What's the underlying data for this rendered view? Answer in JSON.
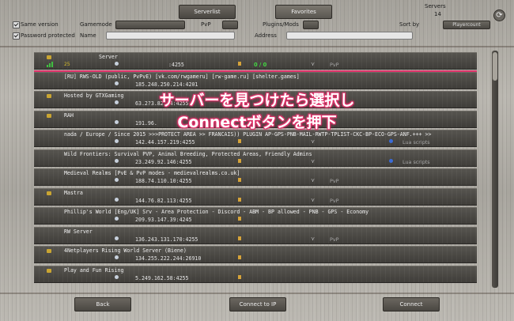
{
  "tabs": [
    {
      "label": "Serverlist",
      "active": true
    },
    {
      "label": "Favorites",
      "active": false
    }
  ],
  "servers_count": {
    "label": "Servers",
    "value": "14"
  },
  "filters": {
    "same_version": "Same version",
    "password_protected": "Password protected",
    "gamemode": "Gamemode",
    "pvp": "PvP",
    "plugins_mods": "Plugins/Mods",
    "name": "Name",
    "address": "Address",
    "sort_by": "Sort by",
    "sort_value": "Playercount"
  },
  "overlay": {
    "line1": "サーバーを見つけたら選択し",
    "line2": "Connectボタンを押下",
    "color": "#e0336b"
  },
  "servers": [
    {
      "name": "Server",
      "address": ":4255",
      "ping": "25",
      "players": "0 / 0",
      "pvp": "PvP",
      "mods": ""
    },
    {
      "name": "[RU] RWS-OLD (public, PvPvE) [vk.com/rwgameru] [rw-game.ru] [shelter.games]",
      "address": "185.248.250.214:4201",
      "ping": "",
      "players": "",
      "pvp": "",
      "mods": ""
    },
    {
      "name": "Hosted by GTXGaming",
      "address": "63.2?3.82.34:4255",
      "ping": "",
      "players": "",
      "pvp": "",
      "mods": ""
    },
    {
      "name": "RAH",
      "address": "191.96.",
      "ping": "",
      "players": "",
      "pvp": "",
      "mods": ""
    },
    {
      "name": "nada / Europe / Since 2015  >>>PROTECT AREA >> FRANCAIS)) PLUGIN AP-GPS-PNB-MAIL-RWTP-TPLIST-CKC-BP-ECO-GPS-ANF.+++ >>",
      "address": "142.44.157.219:4255",
      "ping": "",
      "players": "",
      "pvp": "",
      "mods": "Lua scripts"
    },
    {
      "name": "Wild Frontiers: Survival PVP, Animal Breeding, Protected Areas, Friendly Admins",
      "address": "23.249.92.146:4255",
      "ping": "",
      "players": "",
      "pvp": "",
      "mods": "Lua scripts"
    },
    {
      "name": "Medieval Realms [PvE & PvP modes - medievalrealms.co.uk]",
      "address": "188.74.110.10:4255",
      "ping": "",
      "players": "",
      "pvp": "PvP",
      "mods": ""
    },
    {
      "name": "Mastra",
      "address": "144.76.82.113:4255",
      "ping": "",
      "players": "",
      "pvp": "PvP",
      "mods": ""
    },
    {
      "name": "Phillip's World [Eng/UK] Srv - Area Protection - Discord - ABM - BP allowed - PNB - GPS - Economy",
      "address": "209.93.147.39:4245",
      "ping": "",
      "players": "",
      "pvp": "",
      "mods": ""
    },
    {
      "name": "RW Server",
      "address": "136.243.131.170:4255",
      "ping": "",
      "players": "",
      "pvp": "PvP",
      "mods": ""
    },
    {
      "name": "4Netplayers Rising World Server (Biene)",
      "address": "134.255.222.244:26910",
      "ping": "",
      "players": "",
      "pvp": "",
      "mods": ""
    },
    {
      "name": "Play and Fun Rising",
      "address": "5.249.162.58:4255",
      "ping": "",
      "players": "",
      "pvp": "",
      "mods": ""
    }
  ],
  "buttons": {
    "back": "Back",
    "connect_to_ip": "Connect to IP",
    "connect": "Connect"
  }
}
